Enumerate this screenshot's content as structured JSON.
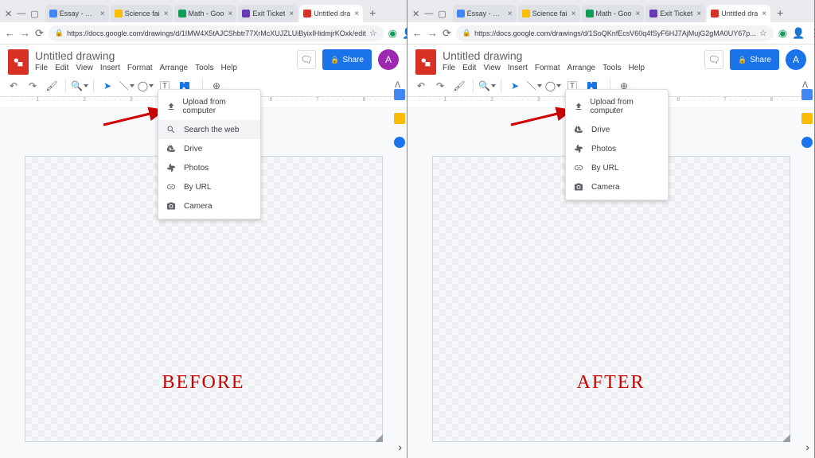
{
  "comparison": {
    "left_label": "BEFORE",
    "right_label": "AFTER"
  },
  "browser": {
    "tabs": [
      {
        "label": "Essay - Goo",
        "color": "#4285f4"
      },
      {
        "label": "Science fai",
        "color": "#fbbc04"
      },
      {
        "label": "Math - Goo",
        "color": "#0f9d58"
      },
      {
        "label": "Exit Ticket",
        "color": "#673ab7"
      },
      {
        "label": "Untitled dra",
        "color": "#d93025",
        "active": true
      }
    ],
    "url_left": "https://docs.google.com/drawings/d/1IMW4X5tAJCShbtr77XrMcXUJZLUiByixIHidmjrKOxk/edit",
    "url_right": "https://docs.google.com/drawings/d/1SoQKnfEcsV60q4fSyF6HJ7AjMujG2gMA0UY67p..."
  },
  "app": {
    "title": "Untitled drawing",
    "menus": [
      "File",
      "Edit",
      "View",
      "Insert",
      "Format",
      "Arrange",
      "Tools",
      "Help"
    ],
    "share": "Share",
    "avatar_left": "A",
    "avatar_right": "A"
  },
  "dropdown": {
    "left_items": [
      {
        "icon": "upload",
        "label": "Upload from computer"
      },
      {
        "icon": "search",
        "label": "Search the web",
        "hi": true
      },
      {
        "icon": "drive",
        "label": "Drive"
      },
      {
        "icon": "photos",
        "label": "Photos"
      },
      {
        "icon": "link",
        "label": "By URL"
      },
      {
        "icon": "camera",
        "label": "Camera"
      }
    ],
    "right_items": [
      {
        "icon": "upload",
        "label": "Upload from computer"
      },
      {
        "icon": "drive",
        "label": "Drive"
      },
      {
        "icon": "photos",
        "label": "Photos"
      },
      {
        "icon": "link",
        "label": "By URL"
      },
      {
        "icon": "camera",
        "label": "Camera"
      }
    ]
  }
}
